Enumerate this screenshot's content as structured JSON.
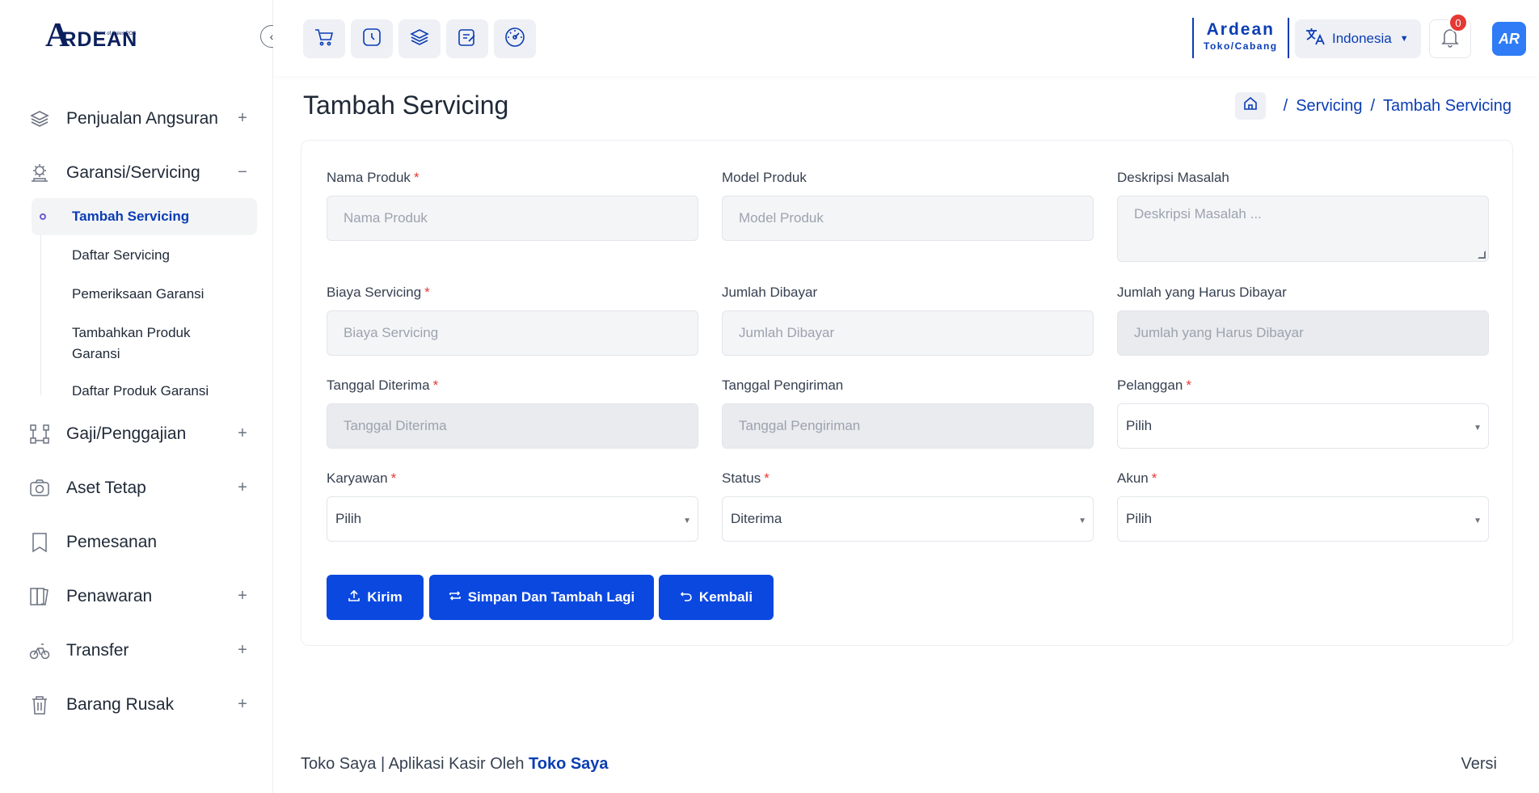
{
  "logo": {
    "mark": "A",
    "text": "RDEAN",
    "tagline": "Point of Sales POS"
  },
  "sidebar": {
    "items": [
      {
        "label": "Penjualan Angsuran",
        "icon": "layers-icon",
        "toggle": "+"
      },
      {
        "label": "Garansi/Servicing",
        "icon": "service-icon",
        "toggle": "−",
        "children": [
          {
            "label": "Tambah Servicing",
            "active": true
          },
          {
            "label": "Daftar Servicing"
          },
          {
            "label": "Pemeriksaan Garansi"
          },
          {
            "label": "Tambahkan Produk Garansi"
          },
          {
            "label": "Daftar Produk Garansi"
          }
        ]
      },
      {
        "label": "Gaji/Penggajian",
        "icon": "org-icon",
        "toggle": "+"
      },
      {
        "label": "Aset Tetap",
        "icon": "camera-icon",
        "toggle": "+"
      },
      {
        "label": "Pemesanan",
        "icon": "bookmark-icon",
        "toggle": ""
      },
      {
        "label": "Penawaran",
        "icon": "book-icon",
        "toggle": "+"
      },
      {
        "label": "Transfer",
        "icon": "bicycle-icon",
        "toggle": "+"
      },
      {
        "label": "Barang Rusak",
        "icon": "trash-icon",
        "toggle": "+"
      }
    ]
  },
  "topbar": {
    "quick_icons": [
      "cart-icon",
      "clock-icon",
      "layers-icon",
      "edit-icon",
      "dashboard-icon"
    ],
    "store_name": "Ardean",
    "store_sub": "Toko/Cabang",
    "language": "Indonesia",
    "notif_count": "0",
    "avatar_text": "AR"
  },
  "page": {
    "title": "Tambah Servicing",
    "breadcrumb": [
      "Servicing",
      "Tambah Servicing"
    ]
  },
  "form": {
    "nama_produk": {
      "label": "Nama Produk",
      "required": "*",
      "placeholder": "Nama Produk"
    },
    "model_produk": {
      "label": "Model Produk",
      "placeholder": "Model Produk"
    },
    "deskripsi": {
      "label": "Deskripsi Masalah",
      "placeholder": "Deskripsi Masalah ..."
    },
    "biaya": {
      "label": "Biaya Servicing",
      "required": "*",
      "placeholder": "Biaya Servicing"
    },
    "jumlah_dibayar": {
      "label": "Jumlah Dibayar",
      "placeholder": "Jumlah Dibayar"
    },
    "jumlah_harus": {
      "label": "Jumlah yang Harus Dibayar",
      "placeholder": "Jumlah yang Harus Dibayar"
    },
    "tanggal_diterima": {
      "label": "Tanggal Diterima",
      "required": "*",
      "placeholder": "Tanggal Diterima"
    },
    "tanggal_pengiriman": {
      "label": "Tanggal Pengiriman",
      "placeholder": "Tanggal Pengiriman"
    },
    "pelanggan": {
      "label": "Pelanggan",
      "required": "*",
      "value": "Pilih"
    },
    "karyawan": {
      "label": "Karyawan",
      "required": "*",
      "value": "Pilih"
    },
    "status": {
      "label": "Status",
      "required": "*",
      "value": "Diterima"
    },
    "akun": {
      "label": "Akun",
      "required": "*",
      "value": "Pilih"
    }
  },
  "buttons": {
    "kirim": "Kirim",
    "simpan_tambah": "Simpan Dan Tambah Lagi",
    "kembali": "Kembali"
  },
  "footer": {
    "left_text": "Toko Saya | Aplikasi Kasir Oleh ",
    "left_brand": "Toko Saya",
    "right_text": "Versi"
  },
  "colors": {
    "primary": "#0b48e0",
    "accent_text": "#0b3db3",
    "required": "#e53935",
    "badge": "#e53935"
  }
}
